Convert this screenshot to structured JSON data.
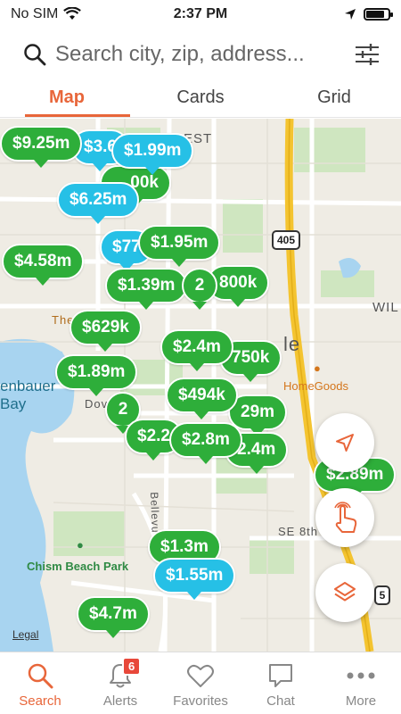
{
  "status": {
    "carrier": "No SIM",
    "time": "2:37 PM",
    "battery_level": 0.85
  },
  "search": {
    "placeholder": "Search city, zip, address..."
  },
  "tabs": [
    {
      "label": "Map",
      "active": true
    },
    {
      "label": "Cards",
      "active": false
    },
    {
      "label": "Grid",
      "active": false
    }
  ],
  "map": {
    "labels": {
      "bay": "enbauer\nBay",
      "park": "Chism Beach Park",
      "homegoods": "HomeGoods",
      "hwy": "405",
      "hwy_right": "5",
      "legal": "Legal",
      "street1": "SE 8th",
      "street2": "Bellevu",
      "wil": "WIL",
      "est": "EST",
      "the": "The",
      "dow": "Dov",
      "le": "le"
    },
    "pins": [
      {
        "price": "$9.25m",
        "color": "green"
      },
      {
        "price": "$3.6",
        "color": "blue"
      },
      {
        "price": "$1.99m",
        "color": "blue"
      },
      {
        "price": "00k",
        "color": "green"
      },
      {
        "price": "$6.25m",
        "color": "blue"
      },
      {
        "price": "$77",
        "color": "blue"
      },
      {
        "price": "$1.95m",
        "color": "green"
      },
      {
        "price": "$4.58m",
        "color": "green"
      },
      {
        "price": "$1.39m",
        "color": "green"
      },
      {
        "price": "2",
        "color": "green"
      },
      {
        "price": "800k",
        "color": "green"
      },
      {
        "price": "$629k",
        "color": "green"
      },
      {
        "price": "$1.89m",
        "color": "green"
      },
      {
        "price": "$2.4m",
        "color": "green"
      },
      {
        "price": "750k",
        "color": "green"
      },
      {
        "price": "$494k",
        "color": "green"
      },
      {
        "price": "29m",
        "color": "green"
      },
      {
        "price": "2",
        "color": "green"
      },
      {
        "price": "$2.2",
        "color": "green"
      },
      {
        "price": "$2.8m",
        "color": "green"
      },
      {
        "price": "2.4m",
        "color": "green"
      },
      {
        "price": "$2.89m",
        "color": "green"
      },
      {
        "price": "$1.3m",
        "color": "green"
      },
      {
        "price": "$1.55m",
        "color": "blue"
      },
      {
        "price": "$4.7m",
        "color": "green"
      }
    ]
  },
  "fabs": {
    "locate": "location-arrow-icon",
    "draw": "hand-draw-icon",
    "layers": "layers-icon"
  },
  "nav": [
    {
      "label": "Search",
      "icon": "search-icon",
      "active": true
    },
    {
      "label": "Alerts",
      "icon": "bell-icon",
      "badge": "6"
    },
    {
      "label": "Favorites",
      "icon": "heart-icon"
    },
    {
      "label": "Chat",
      "icon": "chat-icon"
    },
    {
      "label": "More",
      "icon": "more-icon"
    }
  ],
  "colors": {
    "accent": "#e8663a",
    "pin_green": "#2eae3a",
    "pin_blue": "#26c0e6"
  }
}
